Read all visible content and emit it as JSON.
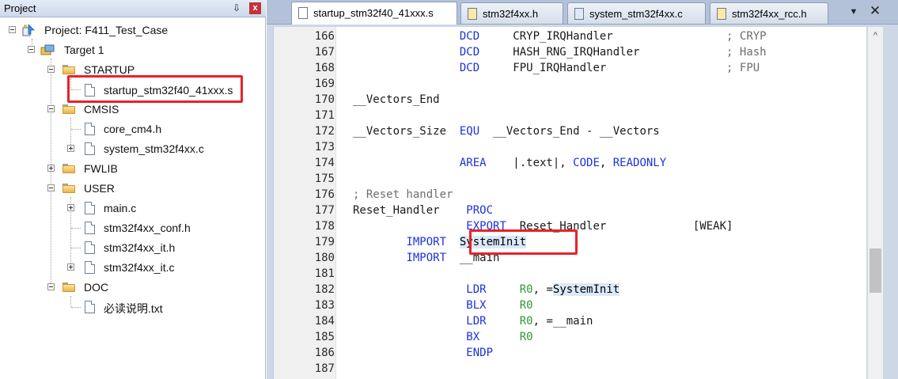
{
  "project_pane": {
    "title": "Project",
    "pin_glyph": "⇩",
    "close_glyph": "x",
    "tree": {
      "project": "Project: F411_Test_Case",
      "target": "Target 1",
      "startup_folder": "STARTUP",
      "startup_file": "startup_stm32f40_41xxx.s",
      "cmsis_folder": "CMSIS",
      "core_file": "core_cm4.h",
      "system_file": "system_stm32f4xx.c",
      "fwlib_folder": "FWLIB",
      "user_folder": "USER",
      "main_file": "main.c",
      "conf_file": "stm32f4xx_conf.h",
      "it_h_file": "stm32f4xx_it.h",
      "it_c_file": "stm32f4xx_it.c",
      "doc_folder": "DOC",
      "readme_file": "必读说明.txt"
    }
  },
  "tabs": [
    {
      "label": "startup_stm32f40_41xxx.s",
      "active": true
    },
    {
      "label": "stm32f4xx.h",
      "active": false
    },
    {
      "label": "system_stm32f4xx.c",
      "active": false
    },
    {
      "label": "stm32f4xx_rcc.h",
      "active": false
    }
  ],
  "tab_controls": {
    "menu_glyph": "▼",
    "close_glyph": "✕"
  },
  "editor": {
    "scroll_up_glyph": "^",
    "lines": [
      {
        "n": "166",
        "parts": [
          [
            "tx",
            "                "
          ],
          [
            "kw",
            "DCD"
          ],
          [
            "tx",
            "     CRYP_IRQHandler                 "
          ],
          [
            "cm",
            "; CRYP"
          ]
        ]
      },
      {
        "n": "167",
        "parts": [
          [
            "tx",
            "                "
          ],
          [
            "kw",
            "DCD"
          ],
          [
            "tx",
            "     HASH_RNG_IRQHandler             "
          ],
          [
            "cm",
            "; Hash"
          ]
        ]
      },
      {
        "n": "168",
        "parts": [
          [
            "tx",
            "                "
          ],
          [
            "kw",
            "DCD"
          ],
          [
            "tx",
            "     FPU_IRQHandler                  "
          ],
          [
            "cm",
            "; FPU"
          ]
        ]
      },
      {
        "n": "169",
        "parts": []
      },
      {
        "n": "170",
        "parts": [
          [
            "tx",
            "__Vectors_End"
          ]
        ]
      },
      {
        "n": "171",
        "parts": []
      },
      {
        "n": "172",
        "parts": [
          [
            "tx",
            "__Vectors_Size  "
          ],
          [
            "kw",
            "EQU"
          ],
          [
            "tx",
            "  __Vectors_End - __Vectors"
          ]
        ]
      },
      {
        "n": "173",
        "parts": []
      },
      {
        "n": "174",
        "parts": [
          [
            "tx",
            "                "
          ],
          [
            "kw",
            "AREA"
          ],
          [
            "tx",
            "    |.text|, "
          ],
          [
            "kw",
            "CODE"
          ],
          [
            "tx",
            ", "
          ],
          [
            "kw",
            "READONLY"
          ]
        ]
      },
      {
        "n": "175",
        "parts": []
      },
      {
        "n": "176",
        "parts": [
          [
            "cm",
            "; Reset handler"
          ]
        ]
      },
      {
        "n": "177",
        "parts": [
          [
            "tx",
            "Reset_Handler    "
          ],
          [
            "kw",
            "PROC"
          ]
        ]
      },
      {
        "n": "178",
        "parts": [
          [
            "tx",
            "                 "
          ],
          [
            "kw",
            "EXPORT"
          ],
          [
            "tx",
            "  Reset_Handler             [WEAK]"
          ]
        ]
      },
      {
        "n": "179",
        "parts": [
          [
            "tx",
            "        "
          ],
          [
            "kw",
            "IMPORT"
          ],
          [
            "tx",
            "  "
          ],
          [
            "hl",
            "SystemInit"
          ]
        ]
      },
      {
        "n": "180",
        "parts": [
          [
            "tx",
            "        "
          ],
          [
            "kw",
            "IMPORT"
          ],
          [
            "tx",
            "  __main"
          ]
        ]
      },
      {
        "n": "181",
        "parts": []
      },
      {
        "n": "182",
        "parts": [
          [
            "tx",
            "                 "
          ],
          [
            "kw",
            "LDR"
          ],
          [
            "tx",
            "     "
          ],
          [
            "rg",
            "R0"
          ],
          [
            "tx",
            ", ="
          ],
          [
            "hl",
            "SystemInit"
          ]
        ]
      },
      {
        "n": "183",
        "parts": [
          [
            "tx",
            "                 "
          ],
          [
            "kw",
            "BLX"
          ],
          [
            "tx",
            "     "
          ],
          [
            "rg",
            "R0"
          ]
        ]
      },
      {
        "n": "184",
        "parts": [
          [
            "tx",
            "                 "
          ],
          [
            "kw",
            "LDR"
          ],
          [
            "tx",
            "     "
          ],
          [
            "rg",
            "R0"
          ],
          [
            "tx",
            ", =__main"
          ]
        ]
      },
      {
        "n": "185",
        "parts": [
          [
            "tx",
            "                 "
          ],
          [
            "kw",
            "BX"
          ],
          [
            "tx",
            "      "
          ],
          [
            "rg",
            "R0"
          ]
        ]
      },
      {
        "n": "186",
        "parts": [
          [
            "tx",
            "                 "
          ],
          [
            "kw",
            "ENDP"
          ]
        ]
      },
      {
        "n": "187",
        "parts": []
      }
    ]
  },
  "colors": {
    "keyword": "#1b33dc",
    "comment": "#6d6d6d",
    "register": "#2f9a2f",
    "highlight_box": "#e5232b"
  }
}
